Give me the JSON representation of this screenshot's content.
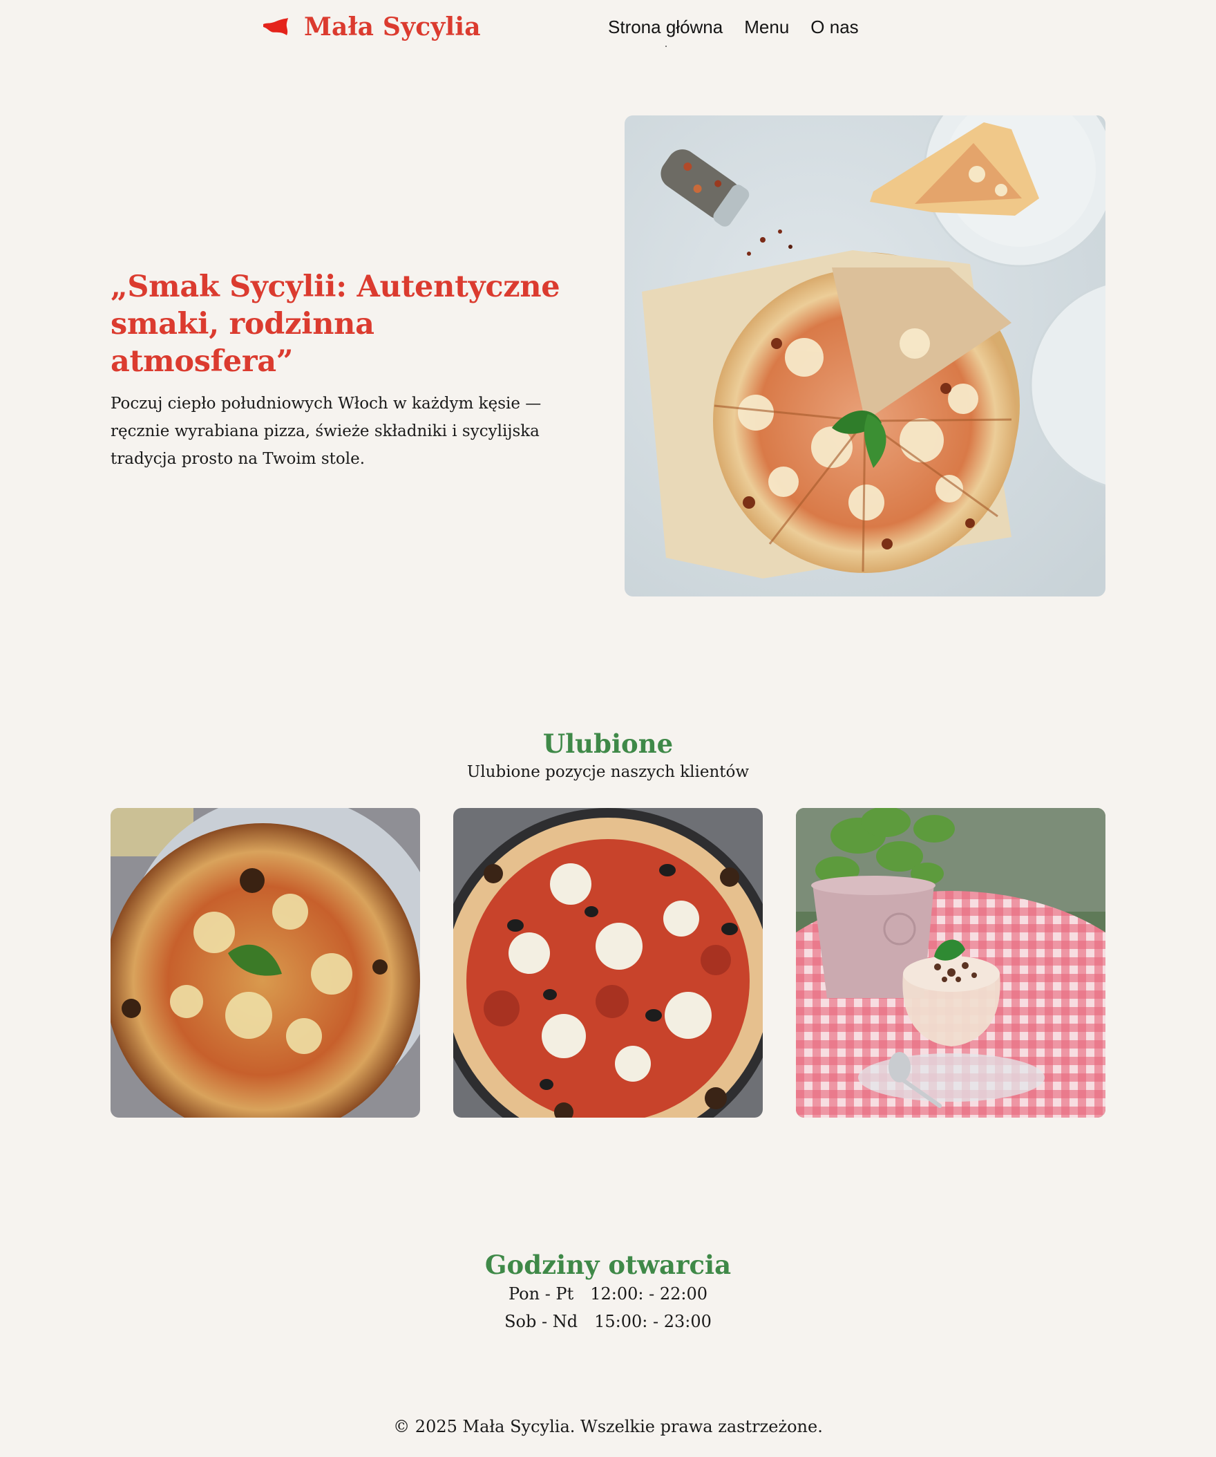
{
  "brand": {
    "name": "Mała Sycylia",
    "logo_icon": "sicily-island-icon",
    "color": "#db3b2f"
  },
  "nav": {
    "items": [
      {
        "label": "Strona główna",
        "active": true
      },
      {
        "label": "Menu",
        "active": false
      },
      {
        "label": "O nas",
        "active": false
      }
    ]
  },
  "hero": {
    "title": "„Smak Sycylii: Autentyczne smaki, rodzinna atmosfera”",
    "lead": "Poczuj ciepło południowych Włoch w każdym kęsie — ręcznie wyrabiana pizza, świeże składniki i sycylijska tradycja prosto na Twoim stole.",
    "image": "pizza-margherita-on-table-photo"
  },
  "favorites": {
    "title": "Ulubione",
    "subtitle": "Ulubione pozycje naszych klientów",
    "items": [
      {
        "image": "pizza-margherita-photo"
      },
      {
        "image": "pizza-salami-olives-photo"
      },
      {
        "image": "tiramisu-dessert-photo"
      }
    ]
  },
  "hours": {
    "title": "Godziny otwarcia",
    "rows": [
      {
        "days": "Pon - Pt",
        "time": "12:00: - 22:00"
      },
      {
        "days": "Sob - Nd",
        "time": "15:00: - 23:00"
      }
    ]
  },
  "footer": {
    "text": "© 2025 Mała Sycylia. Wszelkie prawa zastrzeżone."
  },
  "colors": {
    "accent_red": "#db3b2f",
    "accent_green": "#3f8948",
    "background": "#f6f3ef"
  }
}
